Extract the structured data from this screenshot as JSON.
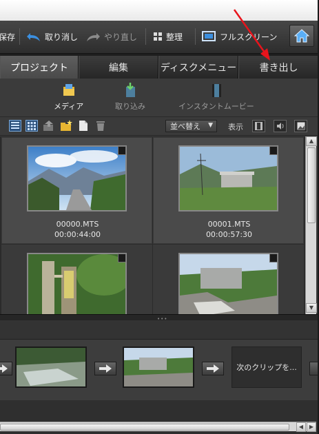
{
  "toolbar": {
    "save_label": "保存",
    "undo_label": "取り消し",
    "redo_label": "やり直し",
    "organize_label": "整理",
    "fullscreen_label": "フルスクリーン"
  },
  "tabs": [
    {
      "label": "プロジェクト",
      "active": true
    },
    {
      "label": "編集",
      "active": false
    },
    {
      "label": "ディスクメニュー",
      "active": false
    },
    {
      "label": "書き出し",
      "active": false
    }
  ],
  "subbar": {
    "media_label": "メディア",
    "import_label": "取り込み",
    "instant_movie_label": "インスタントムービー"
  },
  "viewbar": {
    "sort_label": "並べ替え",
    "display_label": "表示"
  },
  "media": [
    {
      "name": "00000.MTS",
      "duration": "00:00:44:00"
    },
    {
      "name": "00001.MTS",
      "duration": "00:00:57:30"
    },
    {
      "name": "",
      "duration": ""
    },
    {
      "name": "",
      "duration": ""
    }
  ],
  "storyboard": {
    "next_clip_label": "次のクリップを..."
  },
  "colors": {
    "annotation_arrow": "#e8141c",
    "active_tab": "#545454"
  }
}
